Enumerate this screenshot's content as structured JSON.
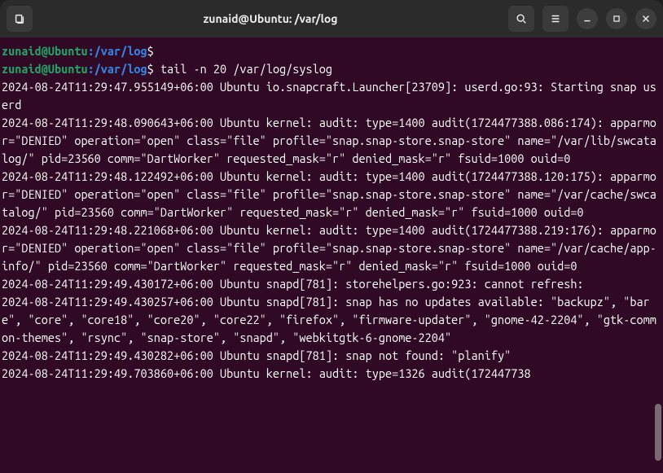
{
  "window": {
    "title": "zunaid@Ubuntu: /var/log"
  },
  "prompt": {
    "user_host": "zunaid@Ubuntu",
    "sep": ":",
    "path": "/var/log",
    "symbol": "$"
  },
  "command": "tail -n 20 /var/log/syslog",
  "output": "2024-08-24T11:29:47.955149+06:00 Ubuntu io.snapcraft.Launcher[23709]: userd.go:93: Starting snap userd\n2024-08-24T11:29:48.090643+06:00 Ubuntu kernel: audit: type=1400 audit(1724477388.086:174): apparmor=\"DENIED\" operation=\"open\" class=\"file\" profile=\"snap.snap-store.snap-store\" name=\"/var/lib/swcatalog/\" pid=23560 comm=\"DartWorker\" requested_mask=\"r\" denied_mask=\"r\" fsuid=1000 ouid=0\n2024-08-24T11:29:48.122492+06:00 Ubuntu kernel: audit: type=1400 audit(1724477388.120:175): apparmor=\"DENIED\" operation=\"open\" class=\"file\" profile=\"snap.snap-store.snap-store\" name=\"/var/cache/swcatalog/\" pid=23560 comm=\"DartWorker\" requested_mask=\"r\" denied_mask=\"r\" fsuid=1000 ouid=0\n2024-08-24T11:29:48.221068+06:00 Ubuntu kernel: audit: type=1400 audit(1724477388.219:176): apparmor=\"DENIED\" operation=\"open\" class=\"file\" profile=\"snap.snap-store.snap-store\" name=\"/var/cache/app-info/\" pid=23560 comm=\"DartWorker\" requested_mask=\"r\" denied_mask=\"r\" fsuid=1000 ouid=0\n2024-08-24T11:29:49.430172+06:00 Ubuntu snapd[781]: storehelpers.go:923: cannot refresh:\n2024-08-24T11:29:49.430257+06:00 Ubuntu snapd[781]: snap has no updates available: \"backupz\", \"bare\", \"core\", \"core18\", \"core20\", \"core22\", \"firefox\", \"firmware-updater\", \"gnome-42-2204\", \"gtk-common-themes\", \"rsync\", \"snap-store\", \"snapd\", \"webkitgtk-6-gnome-2204\"\n2024-08-24T11:29:49.430282+06:00 Ubuntu snapd[781]: snap not found: \"planify\"\n2024-08-24T11:29:49.703860+06:00 Ubuntu kernel: audit: type=1326 audit(172447738"
}
